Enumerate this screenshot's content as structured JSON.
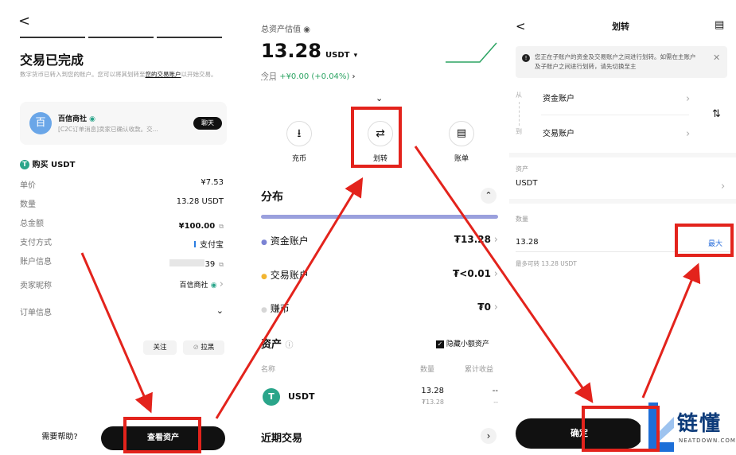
{
  "p1": {
    "back": "<",
    "title": "交易已完成",
    "subtitle_pre": "数字货币已转入到您的账户。您可以将其划转至",
    "subtitle_link": "您的交易账户",
    "subtitle_post": "以开始交易。",
    "merchant_avatar": "百",
    "merchant_name": "百信商社",
    "merchant_msg": "[C2C订单消息]卖家已确认收款。交...",
    "chat_button": "聊天",
    "buy_title": "购买 USDT",
    "rows": [
      {
        "label": "单价",
        "value": "¥7.53"
      },
      {
        "label": "数量",
        "value": "13.28 USDT"
      },
      {
        "label": "总金额",
        "value": "¥100.00"
      },
      {
        "label": "支付方式",
        "value": "支付宝"
      },
      {
        "label": "账户信息",
        "value": "39"
      }
    ],
    "seller_label": "卖家昵称",
    "seller_value": "百信商社",
    "order_info": "订单信息",
    "follow": "关注",
    "block": "拉黑",
    "help": "需要帮助?",
    "view_assets": "查看资产"
  },
  "p2": {
    "total_label": "总资产估值",
    "total_value": "13.28",
    "total_unit": "USDT",
    "today_label": "今日",
    "today_change": "+¥0.00 (+0.04%)",
    "actions": [
      {
        "icon": "deposit-icon",
        "label": "充币"
      },
      {
        "icon": "transfer-icon",
        "label": "划转"
      },
      {
        "icon": "bill-icon",
        "label": "账单"
      }
    ],
    "dist_title": "分布",
    "accounts": [
      {
        "name": "资金账户",
        "value": "₮13.28",
        "color": "#7b83d4"
      },
      {
        "name": "交易账户",
        "value": "₮<0.01",
        "color": "#f2b531"
      },
      {
        "name": "赚币",
        "value": "₮0",
        "color": "#d6d6d6"
      }
    ],
    "assets_title": "资产",
    "hide_small": "隐藏小额资产",
    "col_name": "名称",
    "col_qty": "数量",
    "col_pnl": "累计收益",
    "asset_name": "USDT",
    "asset_qty": "13.28",
    "asset_qty_sub": "₮13.28",
    "asset_pnl": "--",
    "asset_pnl_sub": "--",
    "recent_title": "近期交易"
  },
  "p3": {
    "back": "<",
    "title": "划转",
    "notice": "您正在子账户的资金及交易账户之间进行划转。如需在主账户及子账户之间进行划转，请先切换至主",
    "from_label": "从",
    "from_value": "资金账户",
    "to_label": "到",
    "to_value": "交易账户",
    "asset_label": "资产",
    "asset_value": "USDT",
    "qty_label": "数量",
    "qty_value": "13.28",
    "max": "最大",
    "max_avail": "最多可转 13.28 USDT",
    "confirm": "确定"
  },
  "watermark": {
    "brand": "链懂",
    "domain": "NEATDOWN.COM"
  }
}
